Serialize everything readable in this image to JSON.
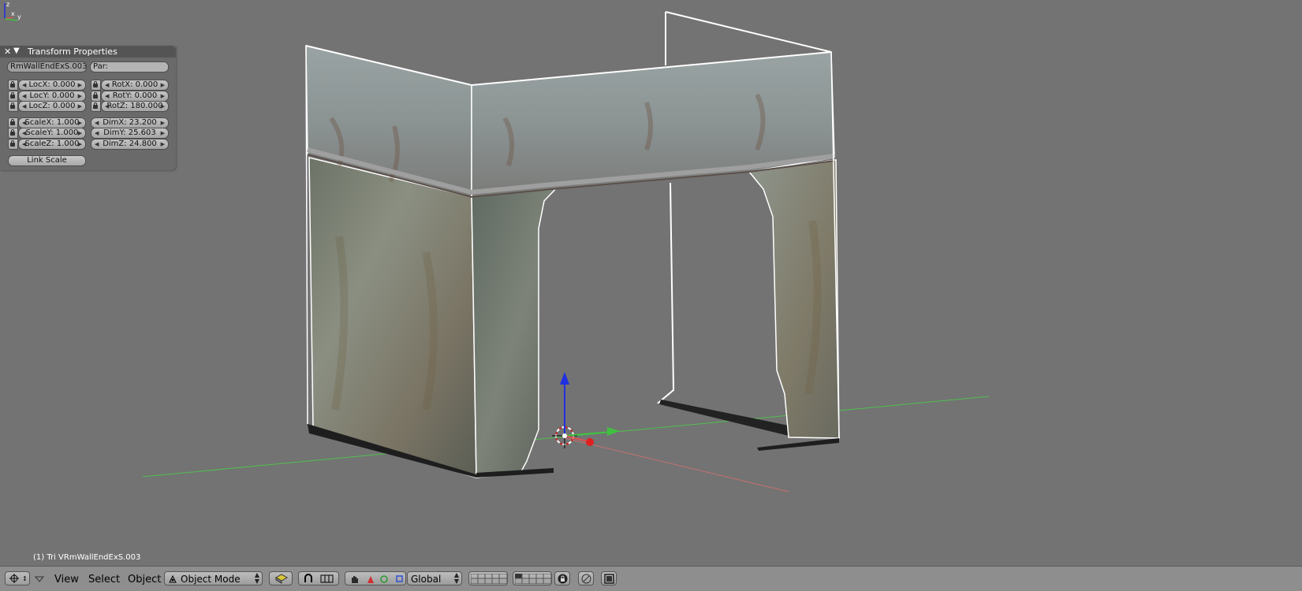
{
  "panel": {
    "title": "Transform Properties",
    "close_icon": "close-icon",
    "collapse_icon": "triangle-down-icon",
    "object_name": "RmWallEndExS.003",
    "parent_label": "Par:",
    "loc": [
      "LocX: 0.000",
      "LocY: 0.000",
      "LocZ: 0.000"
    ],
    "rot": [
      "RotX: 0.000",
      "RotY: 0.000",
      "RotZ: 180.000"
    ],
    "scale": [
      "ScaleX: 1.000",
      "ScaleY: 1.000",
      "ScaleZ: 1.000"
    ],
    "dim": [
      "DimX: 23.200",
      "DimY: 25.603",
      "DimZ: 24.800"
    ],
    "link_scale_label": "Link Scale"
  },
  "viewport": {
    "status": "(1) Tri VRmWallEndExS.003",
    "axis_labels": {
      "x": "x",
      "y": "y",
      "z": "z"
    }
  },
  "header": {
    "menus": [
      "View",
      "Select",
      "Object"
    ],
    "mode": "Object Mode",
    "orientation": "Global"
  },
  "colors": {
    "background": "#737373",
    "x_axis": "#e05050",
    "y_axis": "#40c040",
    "z_axis": "#2030e0",
    "outline": "#ffffff"
  }
}
